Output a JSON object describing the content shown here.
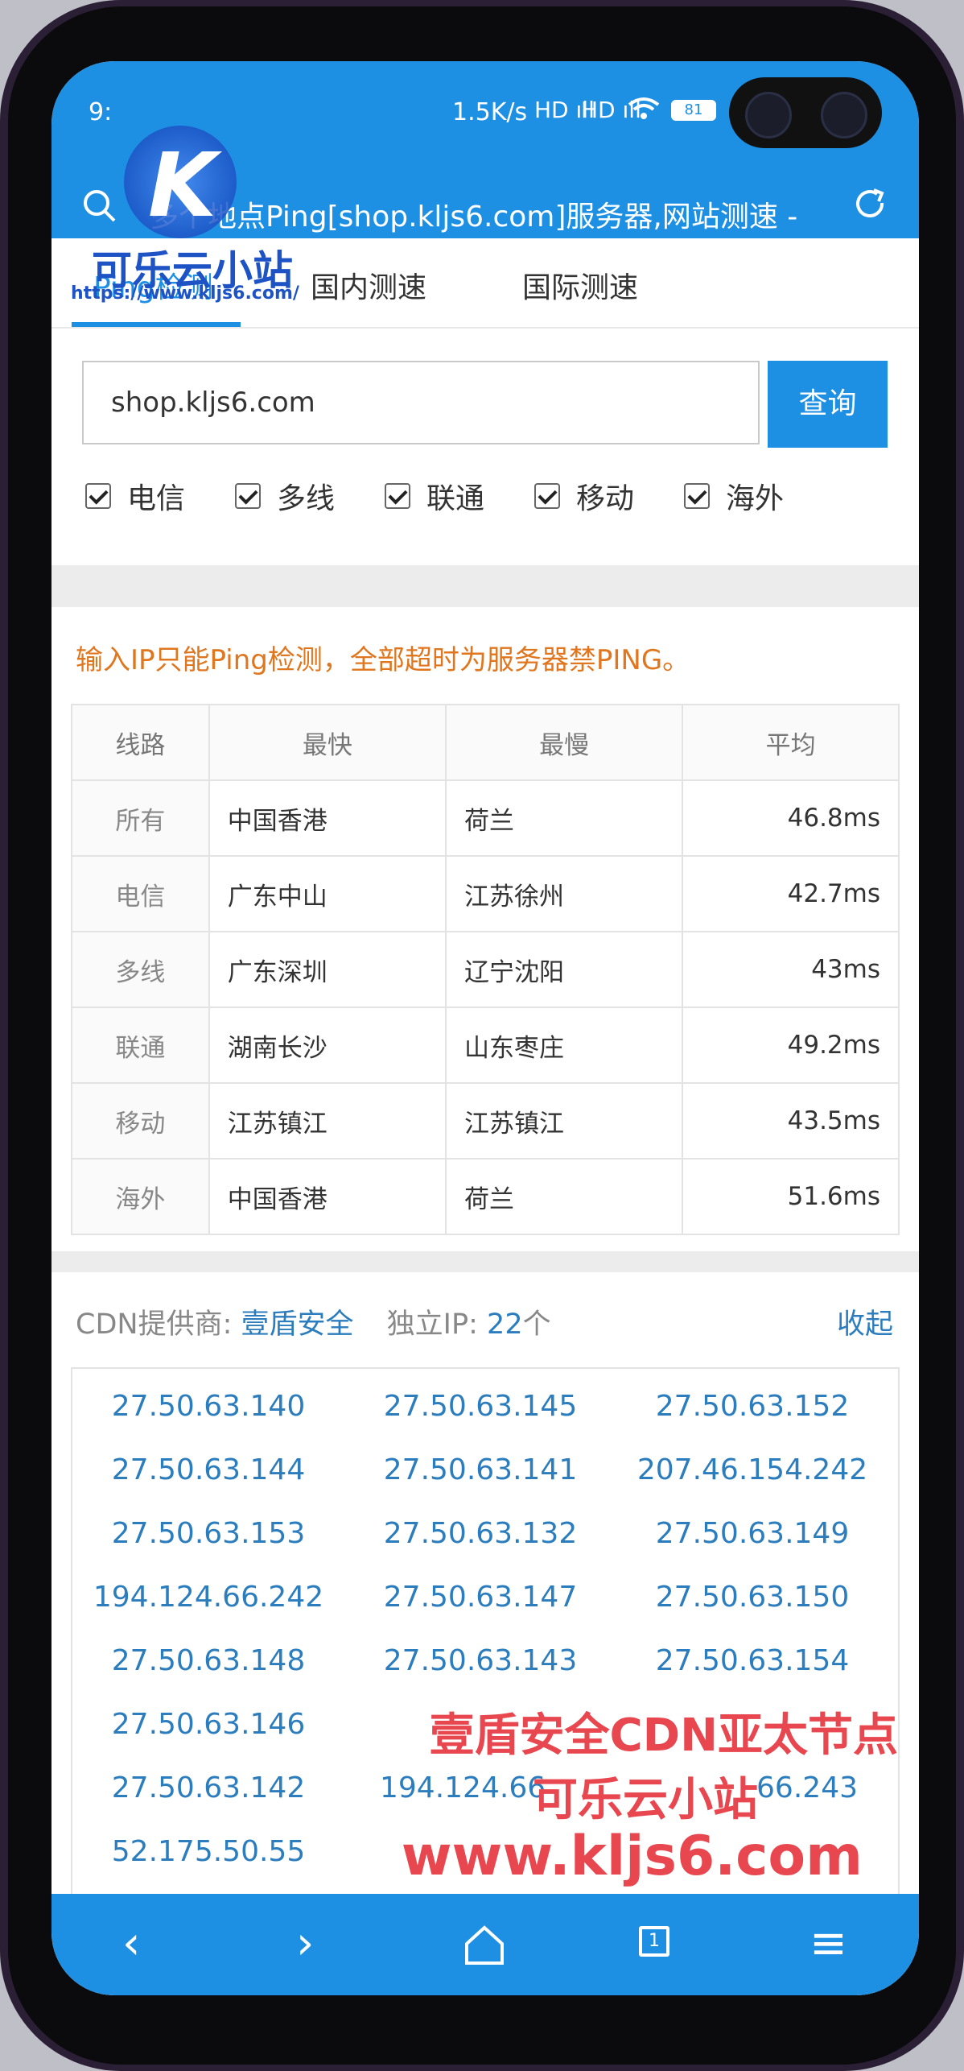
{
  "status_bar": {
    "time": "9:",
    "net_speed": "1.5K/s",
    "signal1": "HD ıll",
    "signal2": "HD ıll",
    "wifi": "wifi",
    "battery": "81"
  },
  "browser": {
    "url_title": "多个地点Ping[shop.kljs6.com]服务器,网站测速 -",
    "search_icon": "search-icon",
    "reload_icon": "reload-icon"
  },
  "watermark": {
    "logo_letter": "K",
    "name": "可乐云小站",
    "url": "https://www.kljs6.com/"
  },
  "tabs": [
    {
      "label": "Ping检测",
      "active": true
    },
    {
      "label": "国内测速",
      "active": false
    },
    {
      "label": "国际测速",
      "active": false
    }
  ],
  "query": {
    "input_value": "shop.kljs6.com",
    "button_label": "查询"
  },
  "filters": [
    {
      "label": "电信",
      "checked": true
    },
    {
      "label": "多线",
      "checked": true
    },
    {
      "label": "联通",
      "checked": true
    },
    {
      "label": "移动",
      "checked": true
    },
    {
      "label": "海外",
      "checked": true
    }
  ],
  "notice": "输入IP只能Ping检测，全部超时为服务器禁PING。",
  "results": {
    "headers": [
      "线路",
      "最快",
      "最慢",
      "平均"
    ],
    "rows": [
      {
        "line": "所有",
        "fastest": "中国香港",
        "slowest": "荷兰",
        "avg": "46.8ms"
      },
      {
        "line": "电信",
        "fastest": "广东中山",
        "slowest": "江苏徐州",
        "avg": "42.7ms"
      },
      {
        "line": "多线",
        "fastest": "广东深圳",
        "slowest": "辽宁沈阳",
        "avg": "43ms"
      },
      {
        "line": "联通",
        "fastest": "湖南长沙",
        "slowest": "山东枣庄",
        "avg": "49.2ms"
      },
      {
        "line": "移动",
        "fastest": "江苏镇江",
        "slowest": "江苏镇江",
        "avg": "43.5ms"
      },
      {
        "line": "海外",
        "fastest": "中国香港",
        "slowest": "荷兰",
        "avg": "51.6ms"
      }
    ]
  },
  "cdn": {
    "provider_label": "CDN提供商:",
    "provider": "壹盾安全",
    "ip_label": "独立IP:",
    "ip_count": "22",
    "ip_unit": "个",
    "collapse_label": "收起"
  },
  "ips": [
    "27.50.63.140",
    "27.50.63.145",
    "27.50.63.152",
    "27.50.63.144",
    "27.50.63.141",
    "207.46.154.242",
    "27.50.63.153",
    "27.50.63.132",
    "27.50.63.149",
    "194.124.66.242",
    "27.50.63.147",
    "27.50.63.150",
    "27.50.63.148",
    "27.50.63.143",
    "27.50.63.154",
    "27.50.63.146",
    "",
    "",
    "27.50.63.142",
    "194.124.66",
    "66.243",
    "52.175.50.55"
  ],
  "overlay": {
    "line1": "壹盾安全CDN亚太节点",
    "line2": "可乐云小站",
    "line3": "www.kljs6.com"
  },
  "navbar": {
    "back": "‹",
    "forward": "›",
    "home": "⌂",
    "tabs_count": "1",
    "menu": "≡"
  }
}
